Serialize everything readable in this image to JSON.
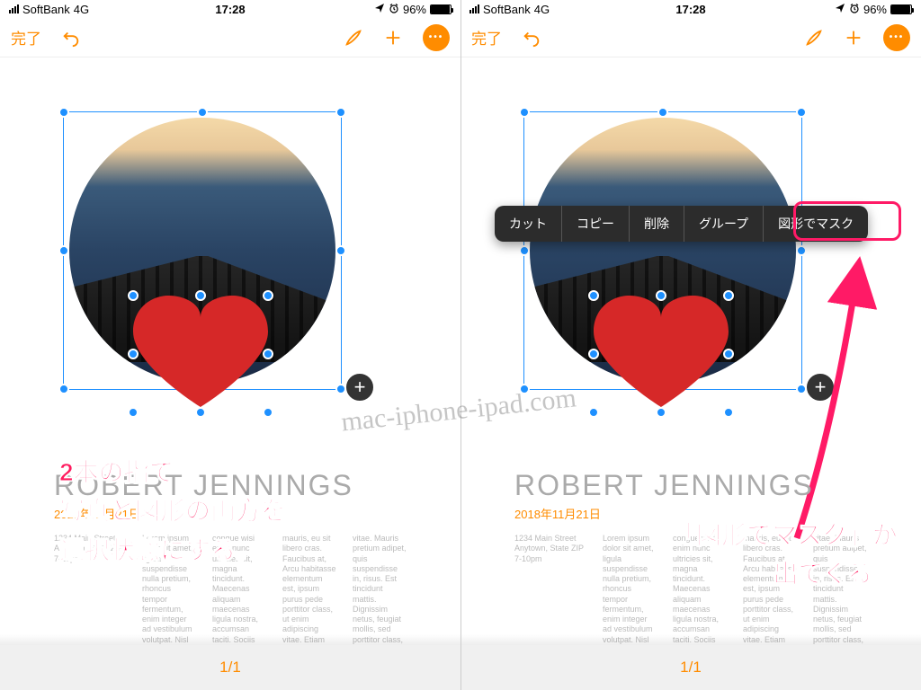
{
  "status": {
    "carrier": "SoftBank",
    "network": "4G",
    "time": "17:28",
    "battery_pct": "96%"
  },
  "toolbar": {
    "done": "完了"
  },
  "document": {
    "title": "ROBERT JENNINGS",
    "date": "2018年11月21日",
    "address_line1": "1234 Main Street",
    "address_line2": "Anytown, State ZIP",
    "address_line3": "7-10pm",
    "lorem1": "Lorem ipsum dolor sit amet, ligula suspendisse nulla pretium, rhoncus tempor fermentum, enim integer ad vestibulum volutpat. Nisl rhoncus turpis est, vel elit.",
    "lorem2": "congue wisi enim nunc ultricies sit, magna tincidunt. Maecenas aliquam maecenas ligula nostra, accumsan taciti. Sociis mauris in integer, a dolor",
    "lorem3": "mauris, eu sit libero cras. Faucibus at, Arcu habitasse elementum est, ipsum purus pede porttitor class, ut enim adipiscing vitae. Etiam aliquam",
    "lorem4": "vitae. Mauris pretium adipet, quis suspendisse in, risus. Est tincidunt mattis. Dignissim netus, feugiat mollis, sed porttitor class, ut enim molestie ut nisl libero nec, diam"
  },
  "context_menu": {
    "cut": "カット",
    "copy": "コピー",
    "delete": "削除",
    "group": "グループ",
    "mask": "図形でマスク"
  },
  "footer": {
    "page": "1/1"
  },
  "annotations": {
    "left_line1": "2本の指で",
    "left_line2": "写真と図形の両方を",
    "left_line3": "選択状態にする。",
    "right_line1": "「図形でマスク」が",
    "right_line2": "出てくる。"
  },
  "watermark": "mac-iphone-ipad.com"
}
